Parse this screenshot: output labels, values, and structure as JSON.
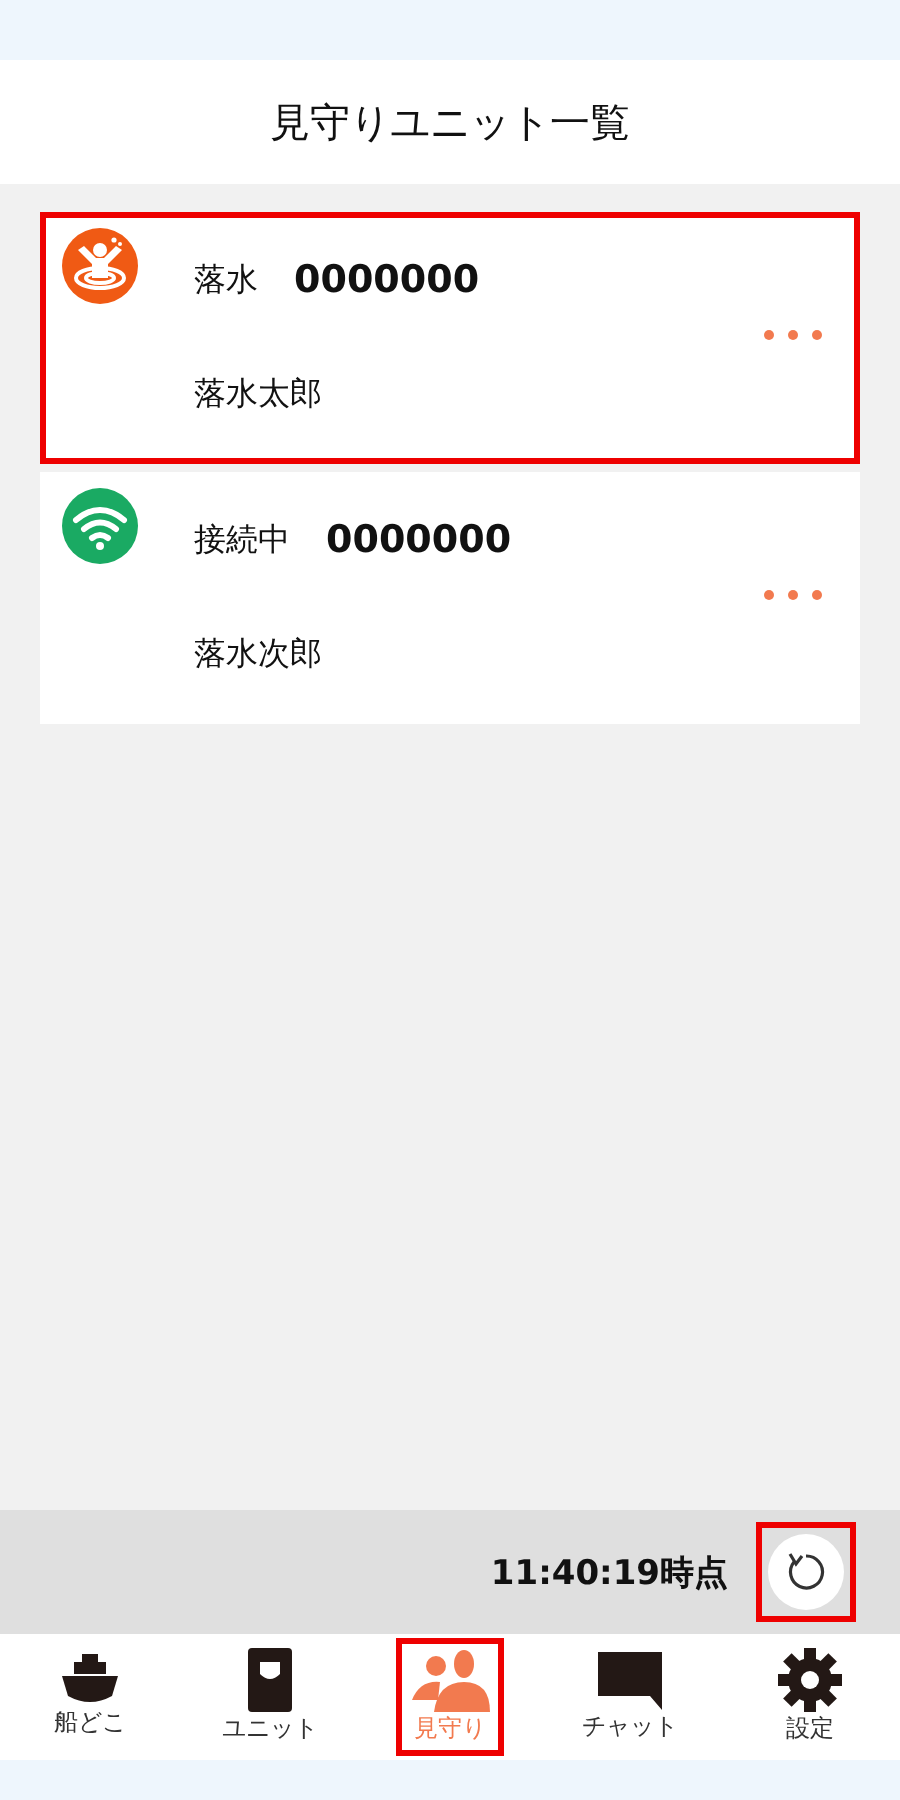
{
  "header": {
    "title": "見守りユニット一覧"
  },
  "units": [
    {
      "kind": "overboard",
      "status": "落水",
      "code": "0000000",
      "name": "落水太郎",
      "highlighted": true
    },
    {
      "kind": "connected",
      "status": "接続中",
      "code": "0000000",
      "name": "落水次郎",
      "highlighted": false
    }
  ],
  "status_bar": {
    "time": "11:40:19時点",
    "refresh_highlighted": true
  },
  "nav": [
    {
      "kind": "ship",
      "label": "船どこ",
      "selected": false,
      "highlighted": false
    },
    {
      "kind": "unit",
      "label": "ユニット",
      "selected": false,
      "highlighted": false
    },
    {
      "kind": "watch",
      "label": "見守り",
      "selected": true,
      "highlighted": true
    },
    {
      "kind": "chat",
      "label": "チャット",
      "selected": false,
      "highlighted": false
    },
    {
      "kind": "settings",
      "label": "設定",
      "selected": false,
      "highlighted": false
    }
  ]
}
